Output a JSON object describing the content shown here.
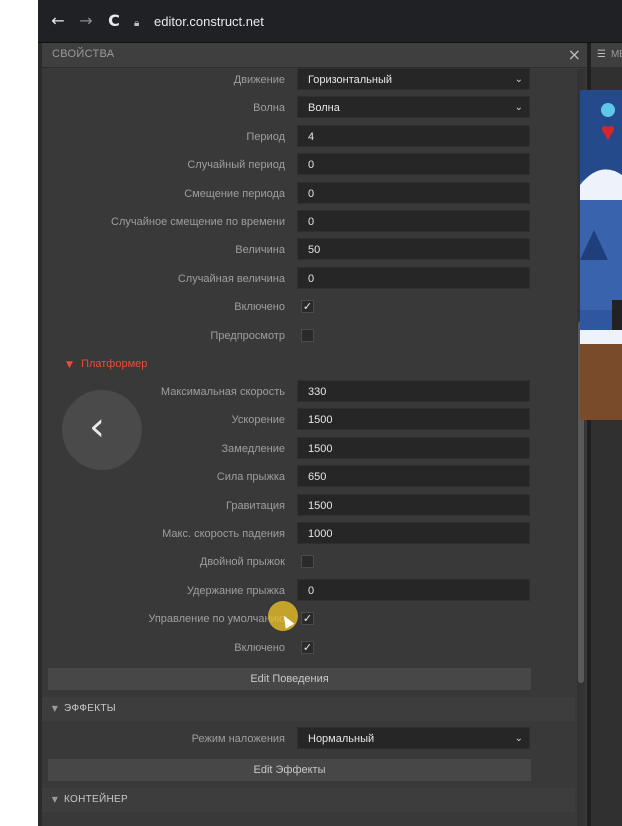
{
  "browser": {
    "back": "←",
    "forward": "→",
    "reload": "C",
    "url": "editor.construct.net"
  },
  "panel": {
    "title": "СВОЙСТВА",
    "close": "×",
    "sine_rows": [
      {
        "label": "Движение",
        "type": "select",
        "value": "Горизонтальный"
      },
      {
        "label": "Волна",
        "type": "select",
        "value": "Волна"
      },
      {
        "label": "Период",
        "type": "text",
        "value": "4"
      },
      {
        "label": "Случайный период",
        "type": "text",
        "value": "0"
      },
      {
        "label": "Смещение периода",
        "type": "text",
        "value": "0"
      },
      {
        "label": "Случайное смещение по времени",
        "type": "text",
        "value": "0"
      },
      {
        "label": "Величина",
        "type": "text",
        "value": "50"
      },
      {
        "label": "Случайная величина",
        "type": "text",
        "value": "0"
      },
      {
        "label": "Включено",
        "type": "check",
        "checked": true
      },
      {
        "label": "Предпросмотр",
        "type": "check",
        "checked": false
      }
    ],
    "platform_section": "Платформер",
    "platform_rows": [
      {
        "label": "Максимальная скорость",
        "type": "text",
        "value": "330"
      },
      {
        "label": "Ускорение",
        "type": "text",
        "value": "1500"
      },
      {
        "label": "Замедление",
        "type": "text",
        "value": "1500"
      },
      {
        "label": "Сила прыжка",
        "type": "text",
        "value": "650"
      },
      {
        "label": "Гравитация",
        "type": "text",
        "value": "1500"
      },
      {
        "label": "Макс. скорость падения",
        "type": "text",
        "value": "1000"
      },
      {
        "label": "Двойной прыжок",
        "type": "check",
        "checked": false
      },
      {
        "label": "Удержание прыжка",
        "type": "text",
        "value": "0"
      },
      {
        "label": "Управление по умолчанию",
        "type": "check",
        "checked": true
      },
      {
        "label": "Включено",
        "type": "check",
        "checked": true
      }
    ],
    "edit_behaviors": "Edit Поведения",
    "effects_header": "ЭФФЕКТЫ",
    "blend_label": "Режим наложения",
    "blend_value": "Нормальный",
    "edit_effects": "Edit Эффекты",
    "container_header": "КОНТЕЙНЕР"
  },
  "menu": {
    "label": "МЕНЮ"
  },
  "colors": {
    "section_red": "#e74c3c",
    "panel_bg": "#393939",
    "field_bg": "#262626",
    "highlight": "#e6be28"
  }
}
